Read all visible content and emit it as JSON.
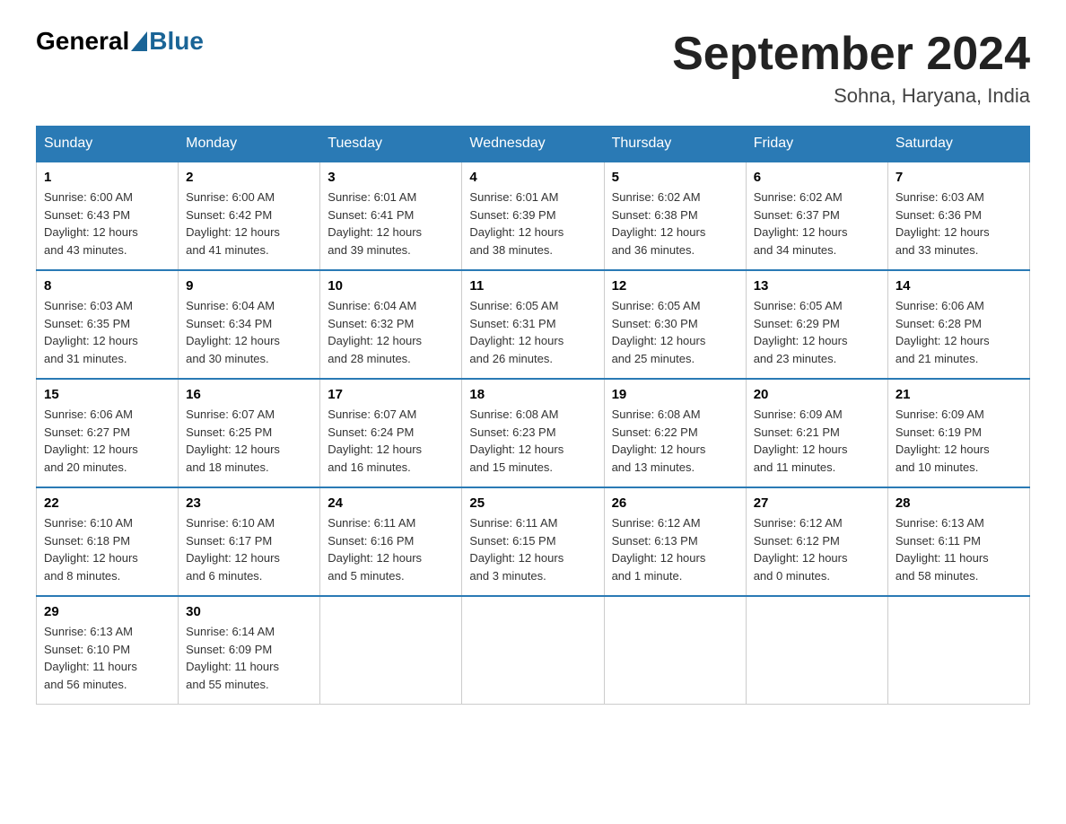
{
  "header": {
    "logo_general": "General",
    "logo_blue": "Blue",
    "month_title": "September 2024",
    "location": "Sohna, Haryana, India"
  },
  "days_of_week": [
    "Sunday",
    "Monday",
    "Tuesday",
    "Wednesday",
    "Thursday",
    "Friday",
    "Saturday"
  ],
  "weeks": [
    [
      {
        "day": "1",
        "sunrise": "6:00 AM",
        "sunset": "6:43 PM",
        "daylight": "12 hours and 43 minutes."
      },
      {
        "day": "2",
        "sunrise": "6:00 AM",
        "sunset": "6:42 PM",
        "daylight": "12 hours and 41 minutes."
      },
      {
        "day": "3",
        "sunrise": "6:01 AM",
        "sunset": "6:41 PM",
        "daylight": "12 hours and 39 minutes."
      },
      {
        "day": "4",
        "sunrise": "6:01 AM",
        "sunset": "6:39 PM",
        "daylight": "12 hours and 38 minutes."
      },
      {
        "day": "5",
        "sunrise": "6:02 AM",
        "sunset": "6:38 PM",
        "daylight": "12 hours and 36 minutes."
      },
      {
        "day": "6",
        "sunrise": "6:02 AM",
        "sunset": "6:37 PM",
        "daylight": "12 hours and 34 minutes."
      },
      {
        "day": "7",
        "sunrise": "6:03 AM",
        "sunset": "6:36 PM",
        "daylight": "12 hours and 33 minutes."
      }
    ],
    [
      {
        "day": "8",
        "sunrise": "6:03 AM",
        "sunset": "6:35 PM",
        "daylight": "12 hours and 31 minutes."
      },
      {
        "day": "9",
        "sunrise": "6:04 AM",
        "sunset": "6:34 PM",
        "daylight": "12 hours and 30 minutes."
      },
      {
        "day": "10",
        "sunrise": "6:04 AM",
        "sunset": "6:32 PM",
        "daylight": "12 hours and 28 minutes."
      },
      {
        "day": "11",
        "sunrise": "6:05 AM",
        "sunset": "6:31 PM",
        "daylight": "12 hours and 26 minutes."
      },
      {
        "day": "12",
        "sunrise": "6:05 AM",
        "sunset": "6:30 PM",
        "daylight": "12 hours and 25 minutes."
      },
      {
        "day": "13",
        "sunrise": "6:05 AM",
        "sunset": "6:29 PM",
        "daylight": "12 hours and 23 minutes."
      },
      {
        "day": "14",
        "sunrise": "6:06 AM",
        "sunset": "6:28 PM",
        "daylight": "12 hours and 21 minutes."
      }
    ],
    [
      {
        "day": "15",
        "sunrise": "6:06 AM",
        "sunset": "6:27 PM",
        "daylight": "12 hours and 20 minutes."
      },
      {
        "day": "16",
        "sunrise": "6:07 AM",
        "sunset": "6:25 PM",
        "daylight": "12 hours and 18 minutes."
      },
      {
        "day": "17",
        "sunrise": "6:07 AM",
        "sunset": "6:24 PM",
        "daylight": "12 hours and 16 minutes."
      },
      {
        "day": "18",
        "sunrise": "6:08 AM",
        "sunset": "6:23 PM",
        "daylight": "12 hours and 15 minutes."
      },
      {
        "day": "19",
        "sunrise": "6:08 AM",
        "sunset": "6:22 PM",
        "daylight": "12 hours and 13 minutes."
      },
      {
        "day": "20",
        "sunrise": "6:09 AM",
        "sunset": "6:21 PM",
        "daylight": "12 hours and 11 minutes."
      },
      {
        "day": "21",
        "sunrise": "6:09 AM",
        "sunset": "6:19 PM",
        "daylight": "12 hours and 10 minutes."
      }
    ],
    [
      {
        "day": "22",
        "sunrise": "6:10 AM",
        "sunset": "6:18 PM",
        "daylight": "12 hours and 8 minutes."
      },
      {
        "day": "23",
        "sunrise": "6:10 AM",
        "sunset": "6:17 PM",
        "daylight": "12 hours and 6 minutes."
      },
      {
        "day": "24",
        "sunrise": "6:11 AM",
        "sunset": "6:16 PM",
        "daylight": "12 hours and 5 minutes."
      },
      {
        "day": "25",
        "sunrise": "6:11 AM",
        "sunset": "6:15 PM",
        "daylight": "12 hours and 3 minutes."
      },
      {
        "day": "26",
        "sunrise": "6:12 AM",
        "sunset": "6:13 PM",
        "daylight": "12 hours and 1 minute."
      },
      {
        "day": "27",
        "sunrise": "6:12 AM",
        "sunset": "6:12 PM",
        "daylight": "12 hours and 0 minutes."
      },
      {
        "day": "28",
        "sunrise": "6:13 AM",
        "sunset": "6:11 PM",
        "daylight": "11 hours and 58 minutes."
      }
    ],
    [
      {
        "day": "29",
        "sunrise": "6:13 AM",
        "sunset": "6:10 PM",
        "daylight": "11 hours and 56 minutes."
      },
      {
        "day": "30",
        "sunrise": "6:14 AM",
        "sunset": "6:09 PM",
        "daylight": "11 hours and 55 minutes."
      },
      null,
      null,
      null,
      null,
      null
    ]
  ],
  "labels": {
    "sunrise": "Sunrise:",
    "sunset": "Sunset:",
    "daylight": "Daylight:"
  }
}
